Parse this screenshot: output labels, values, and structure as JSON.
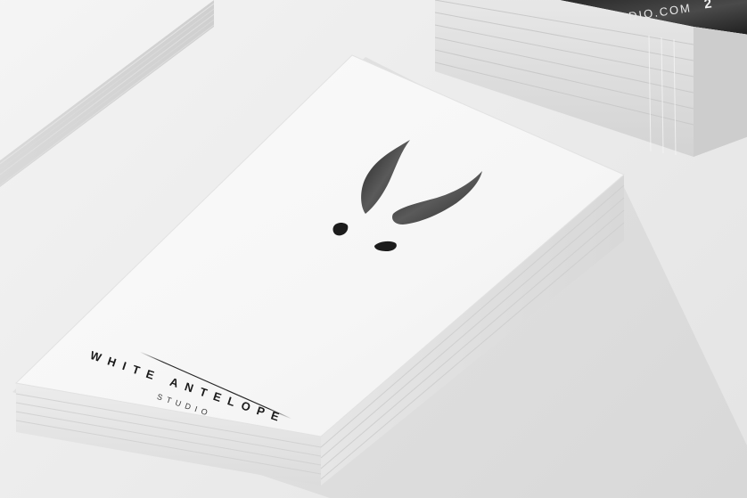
{
  "brand": {
    "name": "WHITE ANTELOPE",
    "sub": "STUDIO"
  },
  "background_card": {
    "partial_text": "DIO.COM",
    "partial_number": "2"
  },
  "colors": {
    "background": "#eeeeee",
    "card": "#f9f9f9",
    "ink": "#1a1a1a"
  }
}
